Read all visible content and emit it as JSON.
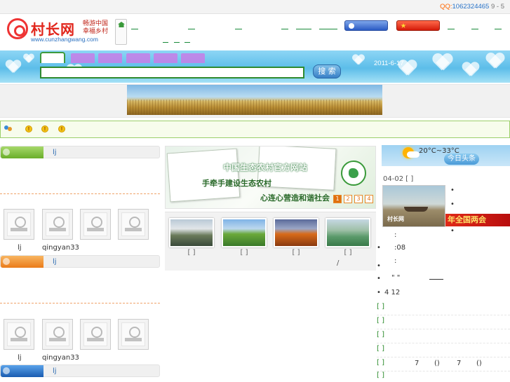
{
  "topbar": {
    "qq_label": "QQ:",
    "qq_number": "1062324465",
    "suffix": "9 - 5"
  },
  "header": {
    "logo_name": "村长网",
    "logo_slogan": "畅游中国 幸福乡村",
    "logo_url": "www.cunzhangwang.com"
  },
  "search": {
    "button": "搜 索",
    "placeholder": "",
    "date": "2011-6-17"
  },
  "notice": {
    "icons": [
      "people-icon",
      "warning-icon",
      "warning-icon",
      "warning-icon"
    ]
  },
  "left": {
    "section1_text": "lj",
    "section1_users": [
      {
        "name": "lj"
      },
      {
        "name": "qingyan33"
      }
    ],
    "section2_text": "lj",
    "section2_users": [
      {
        "name": "lj"
      },
      {
        "name": "qingyan33"
      }
    ],
    "section3_text": "lj",
    "colors": {
      "pill1": "#7dbb3c",
      "pill2": "#f2932f",
      "pill3": "#2d78c8"
    }
  },
  "slide": {
    "title": "中国生态农村官方网站",
    "line1": "手牵手建设生态农村",
    "line2": "心连心营造和谐社会",
    "pages": [
      "1",
      "2",
      "3",
      "4"
    ],
    "active_page": "1"
  },
  "photos": {
    "captions": [
      "[ ]",
      "[ ]",
      "[ ]",
      "[ ]"
    ],
    "slash": "/"
  },
  "right": {
    "temperature": "20°C~33°C",
    "headline_button": "今日头条",
    "news_date": "04-02 [ ]",
    "photo_watermark": "村长网",
    "banner": "年全国两会",
    "bullets": [
      "•",
      "•",
      "•"
    ],
    "lines": [
      ":",
      ":08",
      ":",
      "\"   \"",
      "4 12"
    ],
    "brackets": [
      "[ ]",
      "[ ]",
      "[ ]",
      "[ ]",
      "[ ]",
      "[ ]",
      "[ ]",
      "[ ]"
    ],
    "row5_extra": [
      "7",
      "()",
      "7",
      "()"
    ]
  }
}
